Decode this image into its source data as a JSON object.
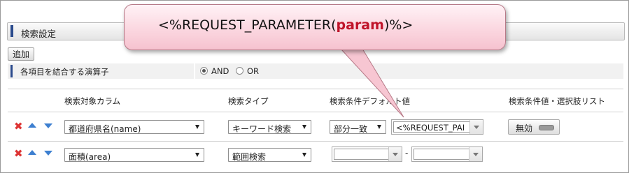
{
  "section": {
    "title": "検索設定"
  },
  "add_button": {
    "label": "追加"
  },
  "operator": {
    "label": "各項目を結合する演算子",
    "options": [
      {
        "label": "AND",
        "checked": true
      },
      {
        "label": "OR",
        "checked": false
      }
    ]
  },
  "columns": {
    "target": "検索対象カラム",
    "type": "検索タイプ",
    "default": "検索条件デフォルト値",
    "list": "検索条件値・選択肢リスト"
  },
  "rows": [
    {
      "column": "都道府県名(name)",
      "search_type": "キーワード検索",
      "match": "部分一致",
      "default_value": "<%REQUEST_PAI",
      "list_toggle": "無効"
    },
    {
      "column": "面積(area)",
      "search_type": "範囲検索",
      "range_from": "",
      "range_separator": "-",
      "range_to": ""
    }
  ],
  "callout": {
    "prefix": "<%REQUEST_PARAMETER(",
    "param": "param",
    "suffix": ")%>"
  },
  "colors": {
    "accent_bar": "#2a4a8c",
    "delete": "#dd3333",
    "arrows": "#3d7fd0",
    "callout_highlight": "#c0142a"
  }
}
